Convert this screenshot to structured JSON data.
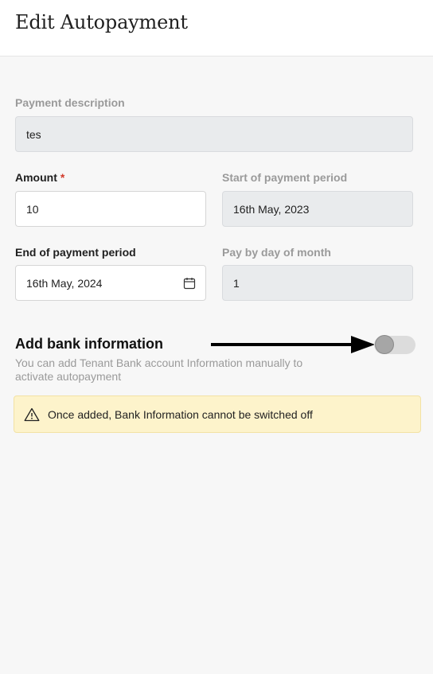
{
  "header": {
    "title": "Edit Autopayment"
  },
  "form": {
    "description": {
      "label": "Payment description",
      "value": "tes"
    },
    "amount": {
      "label": "Amount",
      "required_mark": "*",
      "value": "10"
    },
    "start": {
      "label": "Start of payment period",
      "value": "16th May, 2023"
    },
    "end": {
      "label": "End of payment period",
      "value": "16th May, 2024"
    },
    "pay_day": {
      "label": "Pay by day of month",
      "value": "1"
    }
  },
  "bank": {
    "title": "Add bank information",
    "description": "You can add Tenant Bank account Information manually to activate autopayment",
    "toggle_on": false
  },
  "alert": {
    "text": "Once added, Bank Information cannot be switched off",
    "icon": "warning-icon"
  },
  "colors": {
    "alert_bg": "#fdf3cb",
    "required": "#d23b2b",
    "disabled_field": "#e9ebed"
  }
}
